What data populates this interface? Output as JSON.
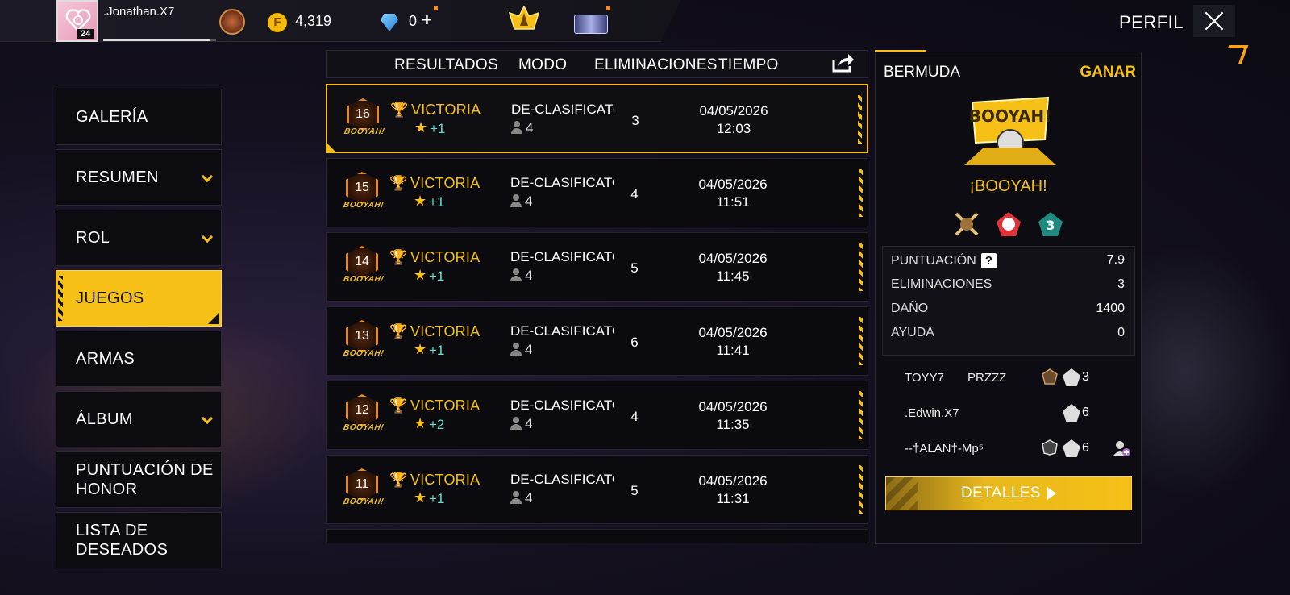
{
  "topbar": {
    "username": ".Jonathan.X7",
    "level": "24",
    "xp_fraction": 0.95,
    "coins": "4,319",
    "diamonds": "0",
    "plus": "+",
    "coin_glyph": "F",
    "profile_label": "PERFIL"
  },
  "sidebar": {
    "items": [
      {
        "label": "GALERÍA",
        "chevron": false
      },
      {
        "label": "RESUMEN",
        "chevron": true
      },
      {
        "label": "ROL",
        "chevron": true
      },
      {
        "label": "JUEGOS",
        "chevron": false,
        "active": true
      },
      {
        "label": "ARMAS",
        "chevron": false
      },
      {
        "label": "ÁLBUM",
        "chevron": true
      },
      {
        "label": "PUNTUACIÓN DE\nHONOR",
        "chevron": false
      },
      {
        "label": "LISTA DE\nDESEADOS",
        "chevron": false
      }
    ]
  },
  "table": {
    "headers": {
      "results": "RESULTADOS",
      "mode": "MODO",
      "kills": "ELIMINACIONES",
      "time": "TIEMPO"
    },
    "badge_text": "BOOYAH!",
    "rows": [
      {
        "badge": "16",
        "result": "VICTORIA",
        "gain": "+1",
        "mode": "DE-CLASIFICATORIA",
        "players": "4",
        "kills": "3",
        "date": "04/05/2026",
        "time": "12:03"
      },
      {
        "badge": "15",
        "result": "VICTORIA",
        "gain": "+1",
        "mode": "DE-CLASIFICATORIA",
        "players": "4",
        "kills": "4",
        "date": "04/05/2026",
        "time": "11:51"
      },
      {
        "badge": "14",
        "result": "VICTORIA",
        "gain": "+1",
        "mode": "DE-CLASIFICATORIA",
        "players": "4",
        "kills": "5",
        "date": "04/05/2026",
        "time": "11:45"
      },
      {
        "badge": "13",
        "result": "VICTORIA",
        "gain": "+1",
        "mode": "DE-CLASIFICATORIA",
        "players": "4",
        "kills": "6",
        "date": "04/05/2026",
        "time": "11:41"
      },
      {
        "badge": "12",
        "result": "VICTORIA",
        "gain": "+2",
        "mode": "DE-CLASIFICATORIA",
        "players": "4",
        "kills": "4",
        "date": "04/05/2026",
        "time": "11:35"
      },
      {
        "badge": "11",
        "result": "VICTORIA",
        "gain": "+1",
        "mode": "DE-CLASIFICATORIA",
        "players": "4",
        "kills": "5",
        "date": "04/05/2026",
        "time": "11:31"
      }
    ]
  },
  "detail": {
    "map": "BERMUDA",
    "outcome": "GANAR",
    "booyah_label": "¡BOOYAH!",
    "booyah_art_text": "BOOYAH!",
    "stats": [
      {
        "key": "PUNTUACIÓN",
        "value": "7.9",
        "help": "?"
      },
      {
        "key": "ELIMINACIONES",
        "value": "3"
      },
      {
        "key": "DAÑO",
        "value": "1400"
      },
      {
        "key": "AYUDA",
        "value": "0"
      }
    ],
    "team": [
      {
        "name": "TOYY7",
        "tag": "PRZZZ",
        "kills": "3"
      },
      {
        "name": ".Edwin.X7",
        "tag": "",
        "kills": "6"
      },
      {
        "name": "--†ALAN†-Mp⁵",
        "tag": "",
        "kills": "6"
      }
    ],
    "details_label": "DETALLES"
  },
  "colors": {
    "accent": "#f6c017",
    "gain": "#5fe0d0",
    "panel_bg": "#0d0c12"
  }
}
